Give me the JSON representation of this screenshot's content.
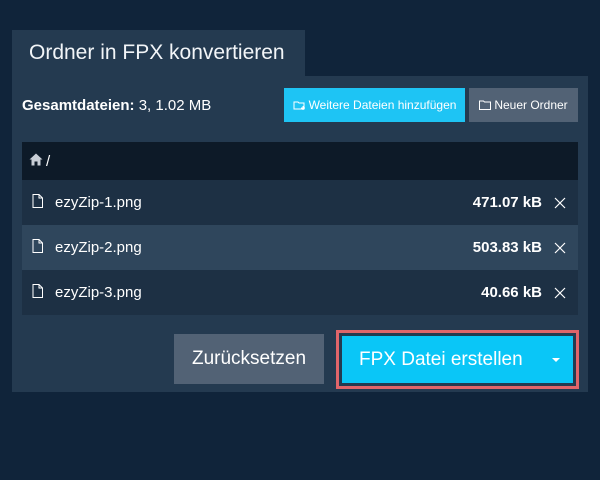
{
  "tab": {
    "title": "Ordner in FPX konvertieren"
  },
  "summary": {
    "label": "Gesamtdateien:",
    "value": "3, 1.02 MB"
  },
  "toolbar": {
    "add_files_label": "Weitere Dateien hinzufügen",
    "new_folder_label": "Neuer Ordner"
  },
  "path": {
    "label": "/"
  },
  "files": [
    {
      "name": "ezyZip-1.png",
      "size": "471.07 kB"
    },
    {
      "name": "ezyZip-2.png",
      "size": "503.83 kB"
    },
    {
      "name": "ezyZip-3.png",
      "size": "40.66 kB"
    }
  ],
  "actions": {
    "reset_label": "Zurücksetzen",
    "create_label": "FPX Datei erstellen"
  },
  "colors": {
    "background": "#10243a",
    "panel": "#243a50",
    "accent": "#0ac6f7",
    "secondary_button": "#526275",
    "highlight_border": "#e0656a"
  },
  "icons": [
    "add-files-icon",
    "folder-icon",
    "home-icon",
    "file-icon",
    "close-icon",
    "caret-down-icon"
  ]
}
